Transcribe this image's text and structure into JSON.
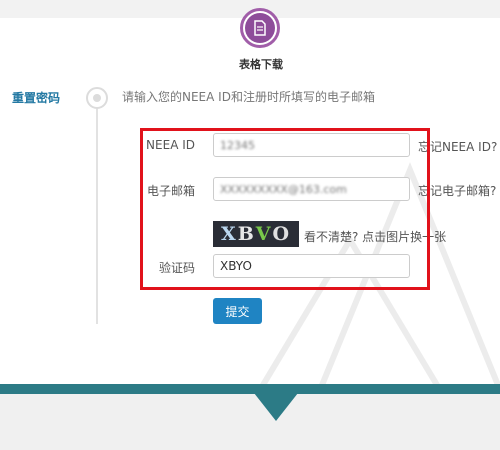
{
  "header": {
    "step_label": "表格下载"
  },
  "sidebar": {
    "title": "重置密码"
  },
  "form": {
    "instruction": "请输入您的NEEA ID和注册时所填写的电子邮箱",
    "neea_id": {
      "label": "NEEA ID",
      "value": "12345",
      "forgot": "忘记NEEA ID?"
    },
    "email": {
      "label": "电子邮箱",
      "value": "XXXXXXXXX@163.com",
      "forgot": "忘记电子邮箱?"
    },
    "captcha": {
      "image_text": "XBVO",
      "hint": "看不清楚? 点击图片换一张",
      "label": "验证码",
      "value": "XBYO"
    },
    "submit": "提交"
  },
  "colors": {
    "accent_purple": "#8e4d9a",
    "title_blue": "#2479a3",
    "button_blue": "#1f84c3",
    "highlight_red": "#e1121b",
    "footer_teal": "#2c7b86"
  }
}
